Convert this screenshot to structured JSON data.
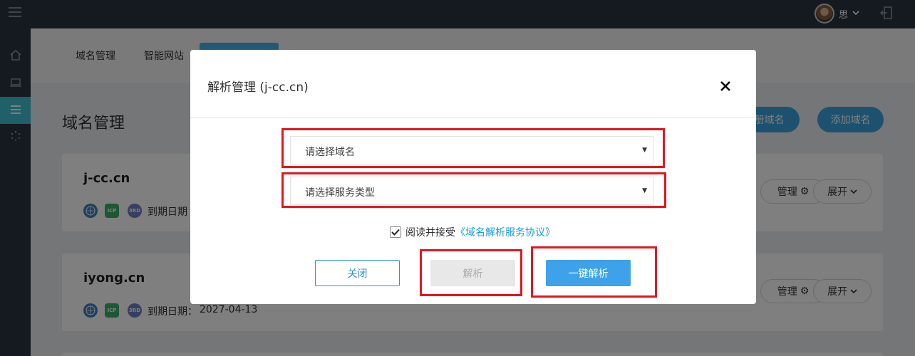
{
  "topbar": {
    "user_name": "思",
    "user_caret": "⌄"
  },
  "sidebar": {
    "items": [
      {
        "icon": "home-icon"
      },
      {
        "icon": "laptop-icon"
      },
      {
        "icon": "list-icon",
        "active": true
      },
      {
        "icon": "loading-icon"
      }
    ]
  },
  "tabs": [
    {
      "label": "域名管理"
    },
    {
      "label": "智能网站"
    },
    {
      "label": ""
    }
  ],
  "page_title": "域名管理",
  "header_buttons": {
    "register": "注册域名",
    "add": "添加域名"
  },
  "domains": [
    {
      "name": "j-cc.cn",
      "expiry_label": "到期日期",
      "expiry_value": "",
      "manage_label": "管理",
      "expand_label": "展开"
    },
    {
      "name": "iyong.cn",
      "expiry_label": "到期日期：",
      "expiry_value": "2027-04-13",
      "manage_label": "管理",
      "expand_label": "展开"
    }
  ],
  "badges": [
    "",
    "ICP",
    "3RD"
  ],
  "modal": {
    "title": "解析管理 (j-cc.cn)",
    "domain_select_placeholder": "请选择域名",
    "service_select_placeholder": "请选择服务类型",
    "agree_checked": true,
    "agree_text": "阅读并接受",
    "agree_link": "《域名解析服务协议》",
    "btn_close": "关闭",
    "btn_parse": "解析",
    "btn_one_click": "一键解析"
  },
  "colors": {
    "topbar": "#2a3542",
    "accent_teal": "#3ec1d3",
    "accent_blue": "#3ea2ea",
    "highlight_red": "#e3161f"
  }
}
